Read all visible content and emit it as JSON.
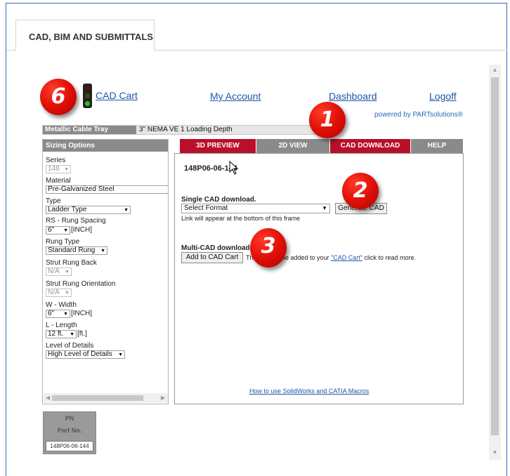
{
  "page": {
    "tab_label": "CAD, BIM AND SUBMITTALS"
  },
  "nav": {
    "cad_cart": "CAD Cart",
    "my_account": "My Account",
    "dashboard": "Dashboard",
    "logoff": "Logoff",
    "powered_by": "powered by PARTsolutions®"
  },
  "system": {
    "label": "Metallic Cable Tray Systems:",
    "value": "3\" NEMA VE 1 Loading Depth"
  },
  "sizing": {
    "header": "Sizing Options",
    "series_label": "Series",
    "series_value": "148",
    "material_label": "Material",
    "material_value": "Pre-Galvanized Steel",
    "type_label": "Type",
    "type_value": "Ladder Type",
    "rs_label": "RS - Rung Spacing",
    "rs_value": "6\"",
    "rs_unit": "[INCH]",
    "rung_type_label": "Rung Type",
    "rung_type_value": "Standard Rung",
    "strut_back_label": "Strut Rung Back",
    "strut_back_value": "N/A",
    "strut_orient_label": "Strut Rung Orientation",
    "strut_orient_value": "N/A",
    "w_label": "W - Width",
    "w_value": "6\"",
    "w_unit": "[INCH]",
    "l_label": "L - Length",
    "l_value": "12 ft.",
    "l_unit": "[ft.]",
    "detail_label": "Level of Details",
    "detail_value": "High Level of Details"
  },
  "tabs": {
    "preview_3d": "3D PREVIEW",
    "view_2d": "2D VIEW",
    "cad_download": "CAD DOWNLOAD",
    "help": "HELP"
  },
  "download": {
    "part_number": "148P06-06-144",
    "single_title": "Single CAD download.",
    "format_select": "Select Format",
    "generate_button": "Generate CAD",
    "link_note": "Link will appear at the bottom of this frame",
    "multi_title": "Multi-CAD download.",
    "add_button": "Add to CAD Cart",
    "multi_note_pre": "The part will be added to your ",
    "cart_link": "\"CAD Cart\"",
    "multi_note_post": " click to read more.",
    "macros_link": "How to use SolidWorks and CATIA Macros"
  },
  "pn_table": {
    "header1": "PN",
    "header2": "Part No.",
    "cell": "148P06-06-144"
  },
  "badges": {
    "b1": "1",
    "b2": "2",
    "b3": "3",
    "b6": "6"
  },
  "colors": {
    "accent_red": "#b8102a",
    "tab_grey": "#8a8a8a",
    "link_blue": "#1d55a6",
    "badge_red": "#e4120a"
  }
}
